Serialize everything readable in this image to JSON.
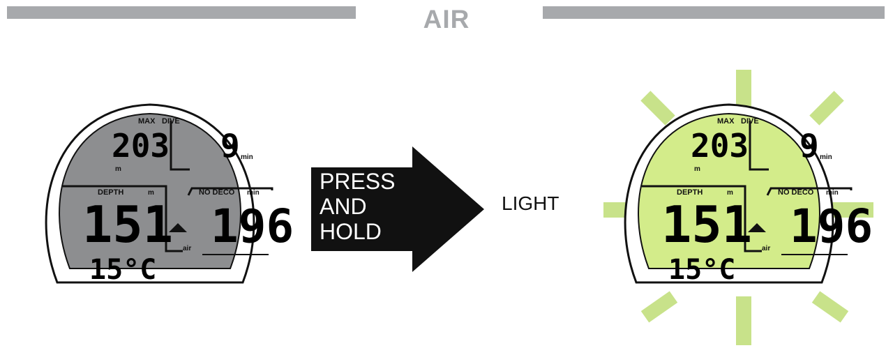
{
  "header": {
    "title": "AIR"
  },
  "display": {
    "max_label": "MAX",
    "dive_label": "DIVE",
    "max_depth_value": "203",
    "max_depth_unit": "m",
    "dive_time_value": "9",
    "dive_time_unit": "min",
    "depth_label": "DEPTH",
    "depth_unit": "m",
    "depth_value": "151",
    "nodeco_label": "NO DECO",
    "nodeco_unit": "min",
    "nodeco_value": "196",
    "air_label": "air",
    "temperature": "15°C"
  },
  "colors": {
    "lcd_off": "#8d8e90",
    "lcd_lit": "#d3ec8a",
    "light_rays": "#c8e28a",
    "header_bar": "#a7a9ac",
    "arrow": "#111111"
  },
  "action": {
    "arrow_lines": [
      "PRESS",
      "AND",
      "HOLD"
    ],
    "result_label": "LIGHT"
  }
}
